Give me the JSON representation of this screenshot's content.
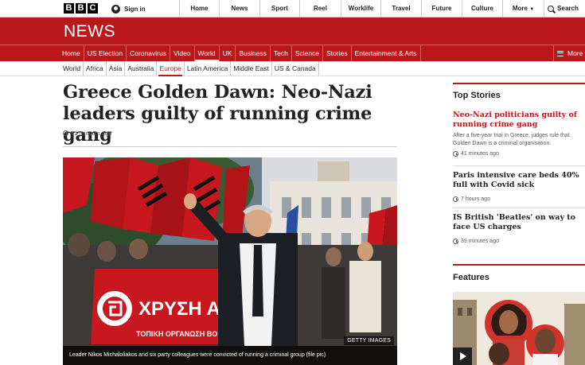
{
  "global": {
    "logo_letters": [
      "B",
      "B",
      "C"
    ],
    "signin_label": "Sign in",
    "nav": [
      "Home",
      "News",
      "Sport",
      "Reel",
      "Worklife",
      "Travel",
      "Future",
      "Culture",
      "More"
    ],
    "search_label": "Search"
  },
  "masthead": {
    "title": "NEWS"
  },
  "navbar": {
    "items": [
      "Home",
      "US Election",
      "Coronavirus",
      "Video",
      "World",
      "UK",
      "Business",
      "Tech",
      "Science",
      "Stories",
      "Entertainment & Arts"
    ],
    "active": "World",
    "more_label": "More"
  },
  "subnav": {
    "items": [
      "World",
      "Africa",
      "Asia",
      "Australia",
      "Europe",
      "Latin America",
      "Middle East",
      "US & Canada"
    ],
    "active": "Europe"
  },
  "article": {
    "headline": "Greece Golden Dawn: Neo-Nazi leaders guilty of running crime gang",
    "timestamp": "41 minutes ago",
    "image_caption": "Leader Nikos Michaloliakos and six party colleagues were convicted of running a criminal group (file pic)",
    "image_credit": "GETTY IMAGES",
    "banner_text": "ΧΡΥΣΗ ΑΥ",
    "banner_subtext": "ΤΟΠΙΚΗ ΟΡΓΑΝΩΣΗ ΒΟΡΕΙΩΝ"
  },
  "sidebar": {
    "top_stories_title": "Top Stories",
    "stories": [
      {
        "title": "Neo-Nazi politicians guilty of running crime gang",
        "summary": "After a five-year trial in Greece, judges rule that Golden Dawn is a criminal organisation.",
        "time": "41 minutes ago"
      },
      {
        "title": "Paris intensive care beds 40% full with Covid sick",
        "summary": "",
        "time": "7 hours ago"
      },
      {
        "title": "IS British 'Beatles' on way to face US charges",
        "summary": "",
        "time": "39 minutes ago"
      }
    ],
    "features_title": "Features"
  },
  "colors": {
    "bbc_red": "#bb1919",
    "text": "#222222",
    "muted": "#5a5a5a"
  }
}
